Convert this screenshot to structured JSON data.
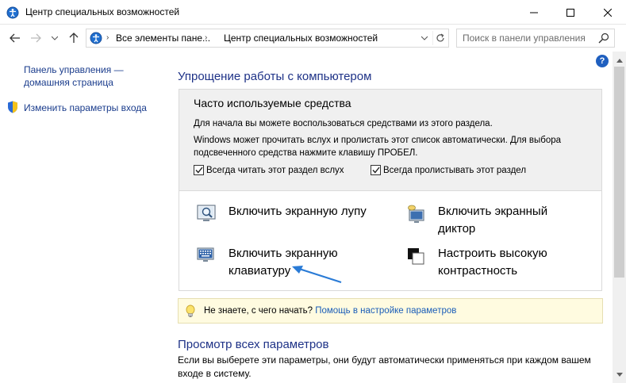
{
  "window": {
    "title": "Центр специальных возможностей"
  },
  "addressbar": {
    "crumb1": "Все элементы пане...",
    "crumb2": "Центр специальных возможностей",
    "separator": "›",
    "search_placeholder": "Поиск в панели управления"
  },
  "sidebar": {
    "home_link": "Панель управления — домашняя страница",
    "signin_link": "Изменить параметры входа"
  },
  "help": {
    "label": "?"
  },
  "main": {
    "heading": "Упрощение работы с компьютером",
    "panel": {
      "heading": "Часто используемые средства",
      "intro": "Для начала вы можете воспользоваться средствами из этого раздела.",
      "desc": "Windows может прочитать вслух и пролистать этот список автоматически. Для выбора подсвеченного средства нажмите клавишу ПРОБЕЛ.",
      "checkbox1": "Всегда читать этот раздел вслух",
      "checkbox2": "Всегда пролистывать этот раздел",
      "checkbox1_checked": true,
      "checkbox2_checked": true
    },
    "tools": [
      {
        "label": "Включить экранную лупу",
        "icon": "magnifier-icon"
      },
      {
        "label": "Включить экранный диктор",
        "icon": "narrator-icon"
      },
      {
        "label": "Включить экранную клавиатуру",
        "icon": "keyboard-icon"
      },
      {
        "label": "Настроить высокую контрастность",
        "icon": "contrast-icon"
      }
    ],
    "tip": {
      "text": "Не знаете, с чего начать?",
      "link": "Помощь в настройке параметров"
    },
    "all_settings_heading": "Просмотр всех параметров",
    "all_settings_desc": "Если вы выберете эти параметры, они будут автоматически применяться при каждом вашем входе в систему."
  },
  "colors": {
    "link": "#1a3c8c",
    "heading": "#1e3287",
    "arrow": "#2a7bd6",
    "tip_bg": "#fffbe0"
  }
}
